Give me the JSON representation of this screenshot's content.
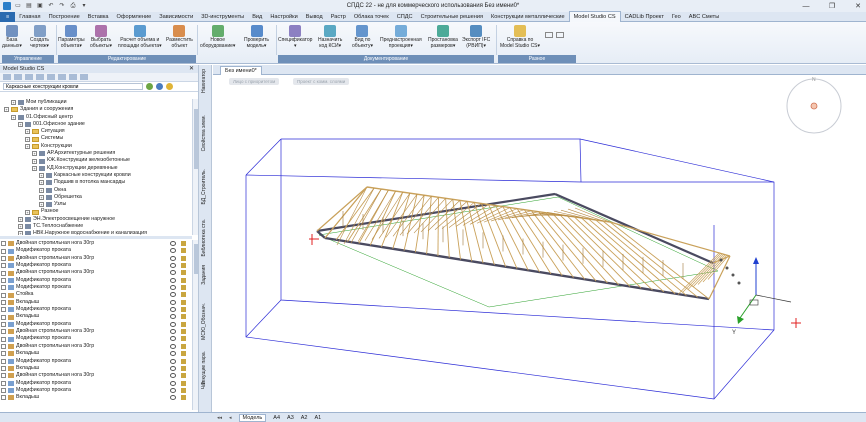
{
  "titlebar": {
    "title": "СПДС 22 - не для коммерческого использования Без имени0*"
  },
  "tabs": [
    {
      "label": "Главная"
    },
    {
      "label": "Построение"
    },
    {
      "label": "Вставка"
    },
    {
      "label": "Оформление"
    },
    {
      "label": "Зависимости"
    },
    {
      "label": "3D-инструменты"
    },
    {
      "label": "Вид"
    },
    {
      "label": "Настройки"
    },
    {
      "label": "Вывод"
    },
    {
      "label": "Растр"
    },
    {
      "label": "Облака точек"
    },
    {
      "label": "СПДС"
    },
    {
      "label": "Строительные решения"
    },
    {
      "label": "Конструкции металлические"
    },
    {
      "label": "Model Studio CS"
    },
    {
      "label": "CADLib Проект"
    },
    {
      "label": "Гео"
    },
    {
      "label": "ABC Сметы"
    }
  ],
  "ribbon": {
    "buttons": [
      {
        "line1": "База",
        "line2": "данных▾"
      },
      {
        "line1": "Создать",
        "line2": "чертеж▾"
      },
      {
        "line1": "Параметры",
        "line2": "объекта▾"
      },
      {
        "line1": "Выбрать",
        "line2": "объекты▾"
      },
      {
        "line1": "Расчет объема и",
        "line2": "площади объекта▾"
      },
      {
        "line1": "Разместить",
        "line2": "объект"
      },
      {
        "line1": "Новое",
        "line2": "оборудование▾"
      },
      {
        "line1": "Проверить",
        "line2": "модель▾"
      },
      {
        "line1": "Спецификатор",
        "line2": "▾"
      },
      {
        "line1": "Назначить",
        "line2": "код КСИ▾"
      },
      {
        "line1": "Вид по",
        "line2": "объекту▾"
      },
      {
        "line1": "Преднастроенная",
        "line2": "проекция▾"
      },
      {
        "line1": "Простановка",
        "line2": "размеров▾"
      },
      {
        "line1": "Экспорт IFC",
        "line2": "(РВИП)▾"
      },
      {
        "line1": "Справка по",
        "line2": "Model Studio CS▾"
      }
    ],
    "groups": [
      {
        "label": "Управление"
      },
      {
        "label": "Редактирование"
      },
      {
        "label": "Документирование"
      },
      {
        "label": "Разное"
      }
    ]
  },
  "leftpanel": {
    "title": "Model Studio CS",
    "search": {
      "value": "Каркасные конструкции кровли"
    },
    "tree": [
      {
        "label": "Мои публикации",
        "indent": 1,
        "kind": "obj"
      },
      {
        "label": "Здания и сооружения",
        "indent": 0,
        "kind": "fold"
      },
      {
        "label": "01.Офисный центр",
        "indent": 1,
        "kind": "obj"
      },
      {
        "label": "001.Офисное здание",
        "indent": 2,
        "kind": "obj"
      },
      {
        "label": "Ситуация",
        "indent": 3,
        "kind": "fold"
      },
      {
        "label": "Системы",
        "indent": 3,
        "kind": "fold"
      },
      {
        "label": "Конструкции",
        "indent": 3,
        "kind": "fold"
      },
      {
        "label": "АР.Архитектурные решения",
        "indent": 4,
        "kind": "obj"
      },
      {
        "label": "КЖ.Конструкции железобетонные",
        "indent": 4,
        "kind": "obj"
      },
      {
        "label": "КД.Конструкции деревянные",
        "indent": 4,
        "kind": "obj"
      },
      {
        "label": "Каркасные конструкции кровли",
        "indent": 5,
        "kind": "obj"
      },
      {
        "label": "Подшив в потолка мансарды",
        "indent": 5,
        "kind": "obj"
      },
      {
        "label": "Окна",
        "indent": 5,
        "kind": "obj"
      },
      {
        "label": "Обрешетка",
        "indent": 5,
        "kind": "obj"
      },
      {
        "label": "Узлы",
        "indent": 5,
        "kind": "obj"
      },
      {
        "label": "Разное",
        "indent": 3,
        "kind": "fold"
      },
      {
        "label": "ЭН.Электроосвещение наружное",
        "indent": 2,
        "kind": "obj"
      },
      {
        "label": "ТС.Теплоснабжение",
        "indent": 2,
        "kind": "obj"
      },
      {
        "label": "НВК.Наружное водоснабжение и канализация",
        "indent": 2,
        "kind": "obj"
      }
    ],
    "list": [
      {
        "label": "Двойная стропильная нога 30гр"
      },
      {
        "label": "Модификатор проката"
      },
      {
        "label": "Двойная стропильная нога 30гр"
      },
      {
        "label": "Модификатор проката"
      },
      {
        "label": "Двойная стропильная нога 30гр"
      },
      {
        "label": "Модификатор проката"
      },
      {
        "label": "Модификатор проката"
      },
      {
        "label": "Стойка"
      },
      {
        "label": "Вкладыш"
      },
      {
        "label": "Модификатор проката"
      },
      {
        "label": "Вкладыш"
      },
      {
        "label": "Модификатор проката"
      },
      {
        "label": "Двойная стропильная нога 30гр"
      },
      {
        "label": "Модификатор проката"
      },
      {
        "label": "Двойная стропильная нога 30гр"
      },
      {
        "label": "Вкладыш"
      },
      {
        "label": "Модификатор проката"
      },
      {
        "label": "Вкладыш"
      },
      {
        "label": "Двойная стропильная нога 30гр"
      },
      {
        "label": "Модификатор проката"
      },
      {
        "label": "Модификатор проката"
      },
      {
        "label": "Вкладыш"
      }
    ],
    "bottom_tabs": [
      {
        "label": "Model Studio CS"
      },
      {
        "label": "Свойства"
      }
    ]
  },
  "sidetabs": [
    {
      "label": "Навигатор"
    },
    {
      "label": "Свойства элем."
    },
    {
      "label": "БД_Строитель."
    },
    {
      "label": "Библиотека ста."
    },
    {
      "label": "Задания"
    },
    {
      "label": "МСЮ_Обознач."
    },
    {
      "label": "Текущие пара."
    },
    {
      "label": "Чат"
    }
  ],
  "viewport": {
    "tab": "Без имени0*",
    "chips": [
      {
        "label": "Лицо с приоритетом"
      },
      {
        "label": "Проект с комм. слоями"
      }
    ]
  },
  "statusbar": {
    "tabs": [
      {
        "label": "Модель"
      },
      {
        "label": "A4"
      },
      {
        "label": "A3"
      },
      {
        "label": "A2"
      },
      {
        "label": "A1"
      }
    ]
  },
  "colors": {
    "accent": "#2a6ab0",
    "timber": "#c9a15a",
    "box_edge": "#2b2bd6",
    "axis_red": "#e02020",
    "axis_green": "#2aa02a",
    "axis_blue": "#2040d0"
  },
  "icons": [
    "database-icon",
    "drawing-icon",
    "params-icon",
    "select-icon",
    "volume-icon",
    "place-icon",
    "equipment-icon",
    "check-icon",
    "specifier-icon",
    "code-icon",
    "view-icon",
    "projection-icon",
    "dimension-icon",
    "export-icon",
    "help-icon",
    "eye-icon",
    "lock-icon",
    "expand-icon",
    "folder-icon",
    "viewcube-icon"
  ]
}
